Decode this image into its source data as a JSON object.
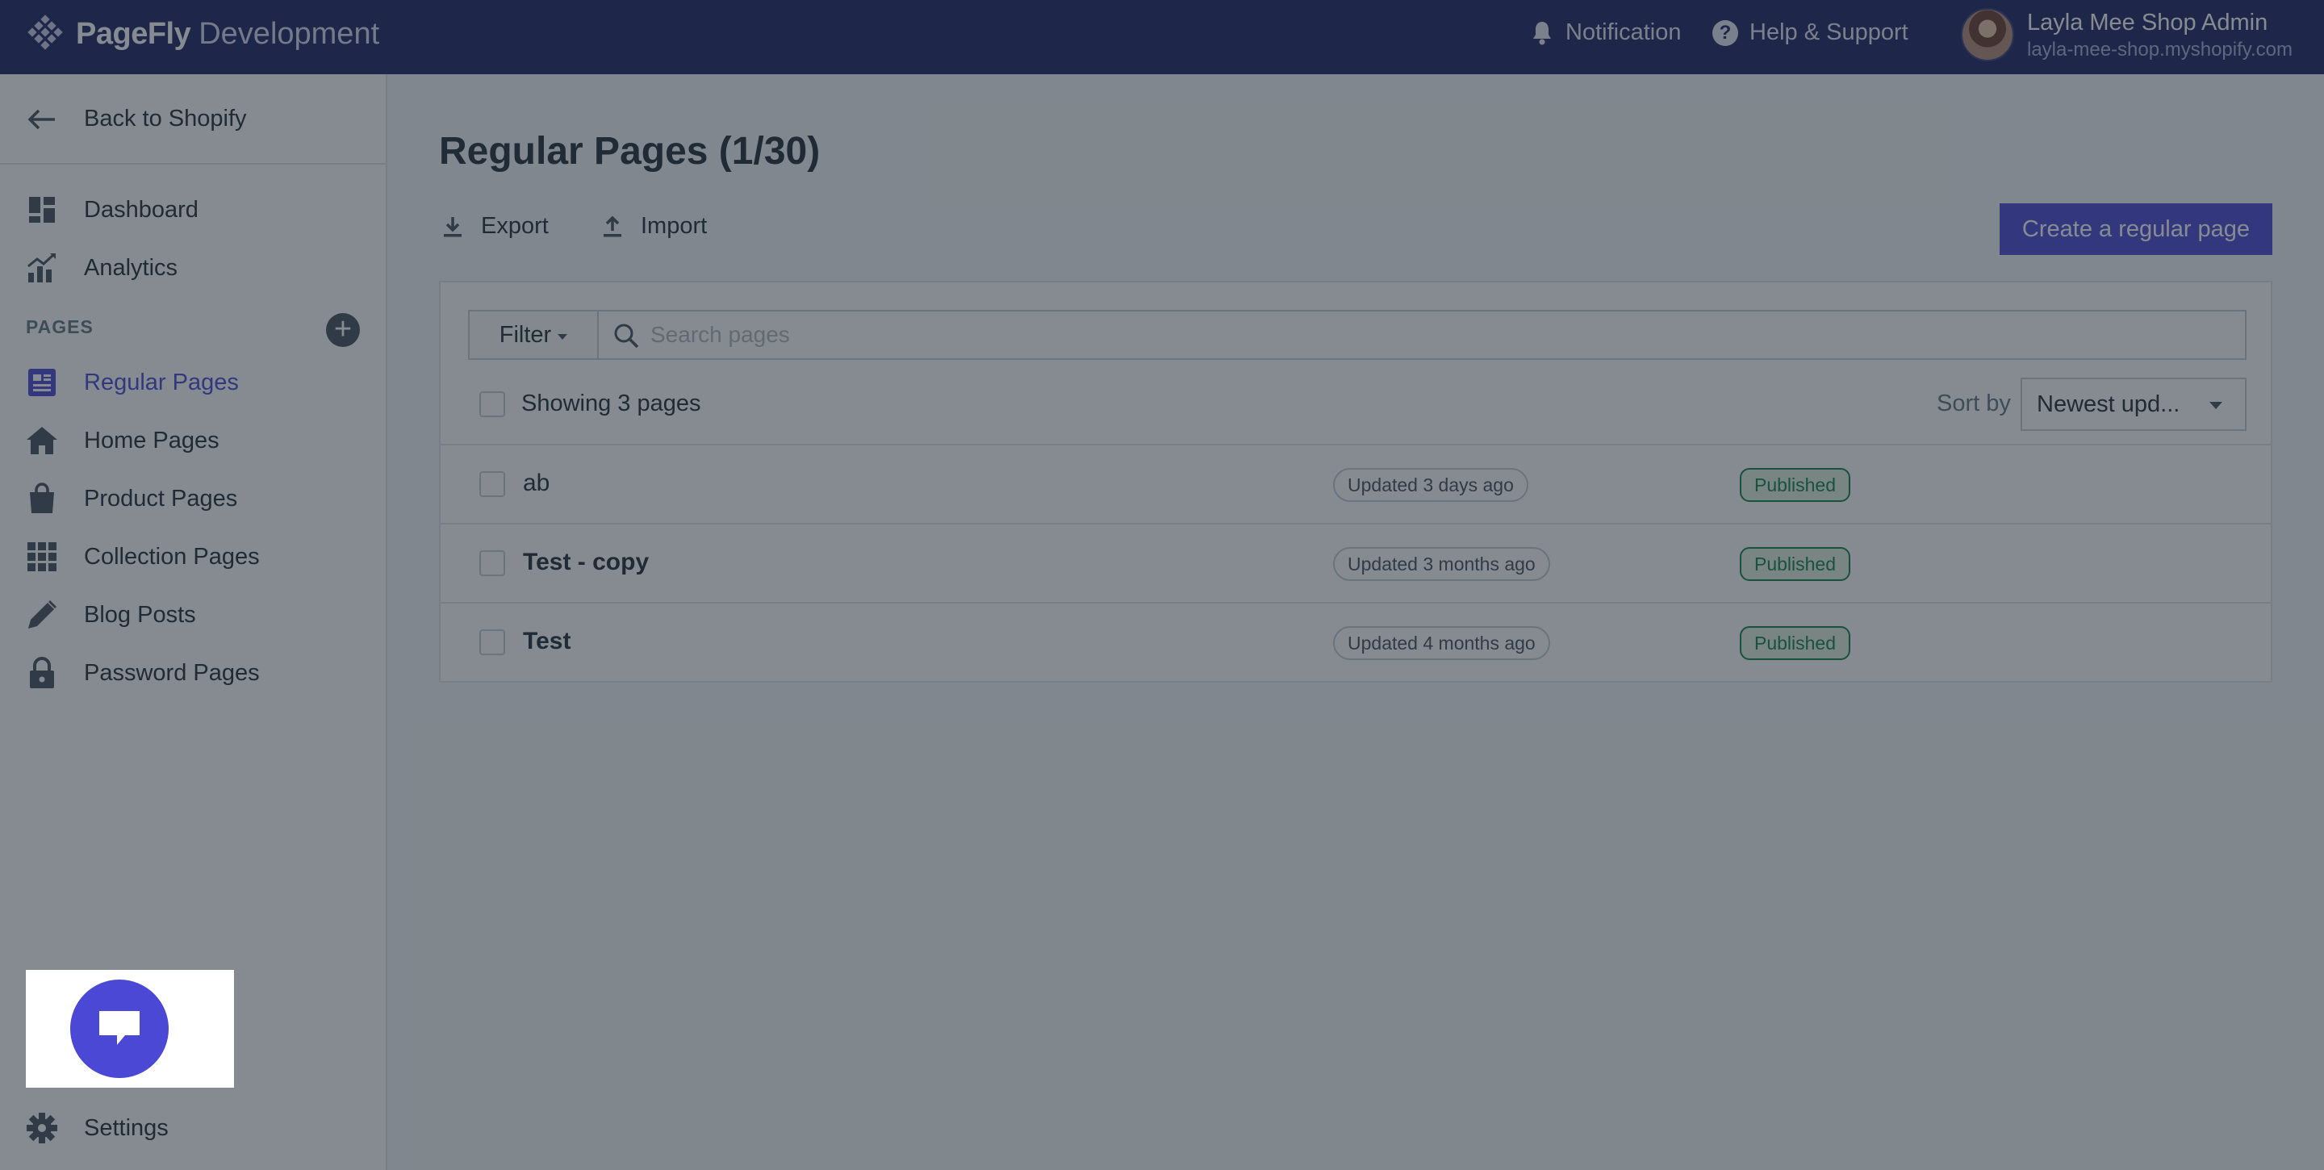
{
  "header": {
    "brand": "PageFly",
    "environment": "Development",
    "notification_label": "Notification",
    "help_label": "Help & Support",
    "user_name": "Layla Mee Shop Admin",
    "user_shop": "layla-mee-shop.myshopify.com"
  },
  "sidebar": {
    "back_label": "Back to Shopify",
    "items": [
      {
        "label": "Dashboard",
        "icon": "dashboard-icon"
      },
      {
        "label": "Analytics",
        "icon": "analytics-icon"
      }
    ],
    "section_title": "PAGES",
    "pages": [
      {
        "label": "Regular Pages",
        "icon": "regular-pages-icon",
        "active": true
      },
      {
        "label": "Home Pages",
        "icon": "home-icon"
      },
      {
        "label": "Product Pages",
        "icon": "shopping-bag-icon"
      },
      {
        "label": "Collection Pages",
        "icon": "grid-icon"
      },
      {
        "label": "Blog Posts",
        "icon": "pencil-icon"
      },
      {
        "label": "Password Pages",
        "icon": "lock-icon"
      }
    ],
    "settings_label": "Settings"
  },
  "main": {
    "title": "Regular Pages (1/30)",
    "export_label": "Export",
    "import_label": "Import",
    "create_label": "Create a regular page",
    "filter_label": "Filter",
    "search_placeholder": "Search pages",
    "showing_label": "Showing 3 pages",
    "sort_label": "Sort by",
    "sort_value": "Newest upd...",
    "rows": [
      {
        "title": "ab",
        "updated": "Updated 3 days ago",
        "status": "Published"
      },
      {
        "title": "Test - copy",
        "updated": "Updated 3 months ago",
        "status": "Published"
      },
      {
        "title": "Test",
        "updated": "Updated 4 months ago",
        "status": "Published"
      }
    ]
  },
  "colors": {
    "topbar": "#1c2260",
    "accent": "#4b48d6",
    "published": "#108043"
  }
}
